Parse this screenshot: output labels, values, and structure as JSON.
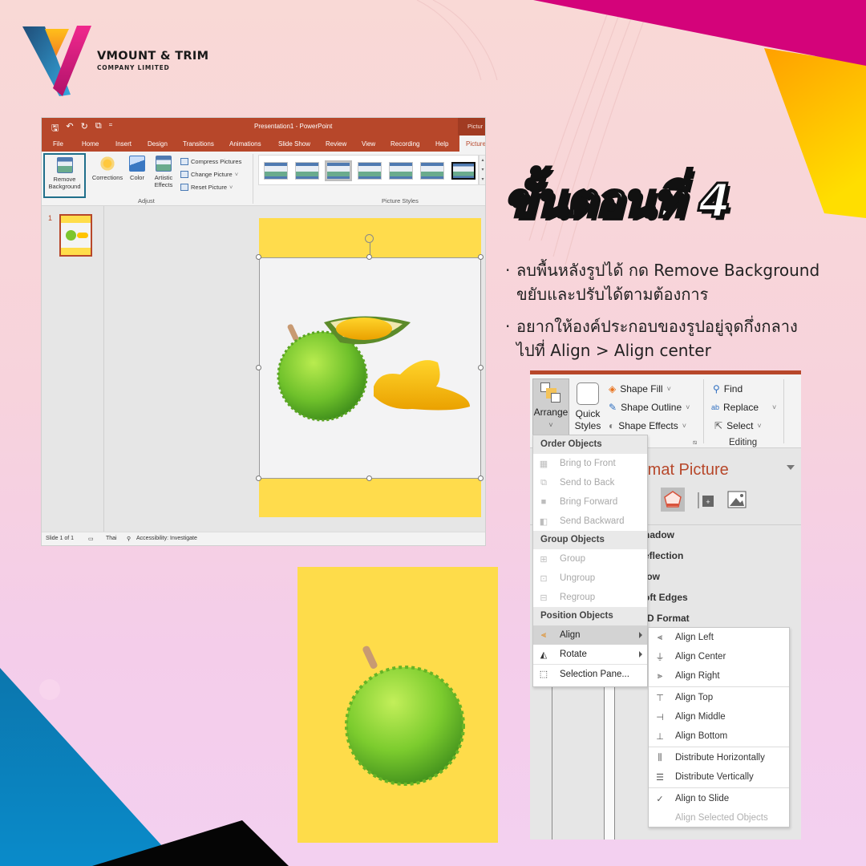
{
  "brand": {
    "name": "VMOUNT & TRIM",
    "subtitle": "COMPANY LIMITED",
    "colors": {
      "magenta": "#d4037a",
      "orange": "#ffa500",
      "yellow": "#ffdc4a",
      "blue": "#0a82bf",
      "ppt_red": "#b7472a"
    }
  },
  "ppt_window": {
    "title": "Presentation1 - PowerPoint",
    "context_tab_top": "Pictur",
    "tabs": [
      {
        "label": "File"
      },
      {
        "label": "Home"
      },
      {
        "label": "Insert"
      },
      {
        "label": "Design"
      },
      {
        "label": "Transitions"
      },
      {
        "label": "Animations"
      },
      {
        "label": "Slide Show"
      },
      {
        "label": "Review"
      },
      {
        "label": "View"
      },
      {
        "label": "Recording"
      },
      {
        "label": "Help"
      },
      {
        "label": "Picture",
        "active": true
      }
    ],
    "ribbon": {
      "remove_background": "Remove Background",
      "corrections": "Corrections",
      "color": "Color",
      "artistic_effects": "Artistic Effects",
      "compress_pictures": "Compress Pictures",
      "change_picture": "Change Picture",
      "reset_picture": "Reset Picture",
      "adjust_group": "Adjust",
      "picture_styles_group": "Picture Styles",
      "picture_style_count": 7
    },
    "thumbnail_number": "1",
    "status": {
      "slide": "Slide 1 of 1",
      "language": "Thai",
      "accessibility": "Accessibility: Investigate"
    }
  },
  "heading": "ขั้นตอนที่ 4",
  "bullets": [
    {
      "text": "ลบพื้นหลังรูปได้ กด Remove Background\nขยับและปรับได้ตามต้องการ"
    },
    {
      "text": "อยากให้องค์ประกอบของรูปอยู่จุดกึ่งกลาง\nไปที่ Align > Align center"
    }
  ],
  "format_ribbon": {
    "arrange": "Arrange",
    "quick_styles": "Quick Styles",
    "shape_fill": "Shape Fill",
    "shape_outline": "Shape Outline",
    "shape_effects": "Shape Effects",
    "find": "Find",
    "replace": "Replace",
    "select": "Select",
    "editing_group": "Editing"
  },
  "format_pane": {
    "title": "rmat Picture",
    "sections": [
      "hadow",
      "eflection",
      "low",
      "oft Edges",
      "-D Format"
    ]
  },
  "arrange_menu": {
    "order_header": "Order Objects",
    "order_items": [
      {
        "label": "Bring to Front",
        "icon": "bring-to-front-icon",
        "disabled": true
      },
      {
        "label": "Send to Back",
        "icon": "send-to-back-icon",
        "disabled": true
      },
      {
        "label": "Bring Forward",
        "icon": "bring-forward-icon",
        "disabled": true
      },
      {
        "label": "Send Backward",
        "icon": "send-backward-icon",
        "disabled": true
      }
    ],
    "group_header": "Group Objects",
    "group_items": [
      {
        "label": "Group",
        "disabled": true
      },
      {
        "label": "Ungroup",
        "disabled": true
      },
      {
        "label": "Regroup",
        "disabled": true
      }
    ],
    "position_header": "Position Objects",
    "position_items": [
      {
        "label": "Align",
        "highlighted": true,
        "submenu": true
      },
      {
        "label": "Rotate",
        "submenu": true
      },
      {
        "label": "Selection Pane..."
      }
    ]
  },
  "align_submenu": {
    "items": [
      {
        "label": "Align Left",
        "glyph": "⫷"
      },
      {
        "label": "Align Center",
        "glyph": "⏚"
      },
      {
        "label": "Align Right",
        "glyph": "⫸"
      },
      {
        "label": "Align Top",
        "glyph": "⊤"
      },
      {
        "label": "Align Middle",
        "glyph": "⊣"
      },
      {
        "label": "Align Bottom",
        "glyph": "⊥"
      },
      {
        "label": "Distribute Horizontally",
        "glyph": "⫼"
      },
      {
        "label": "Distribute Vertically",
        "glyph": "☰"
      },
      {
        "label": "Align to Slide",
        "glyph": "✓",
        "checked": true
      },
      {
        "label": "Align Selected Objects",
        "glyph": "",
        "disabled": true
      }
    ]
  }
}
